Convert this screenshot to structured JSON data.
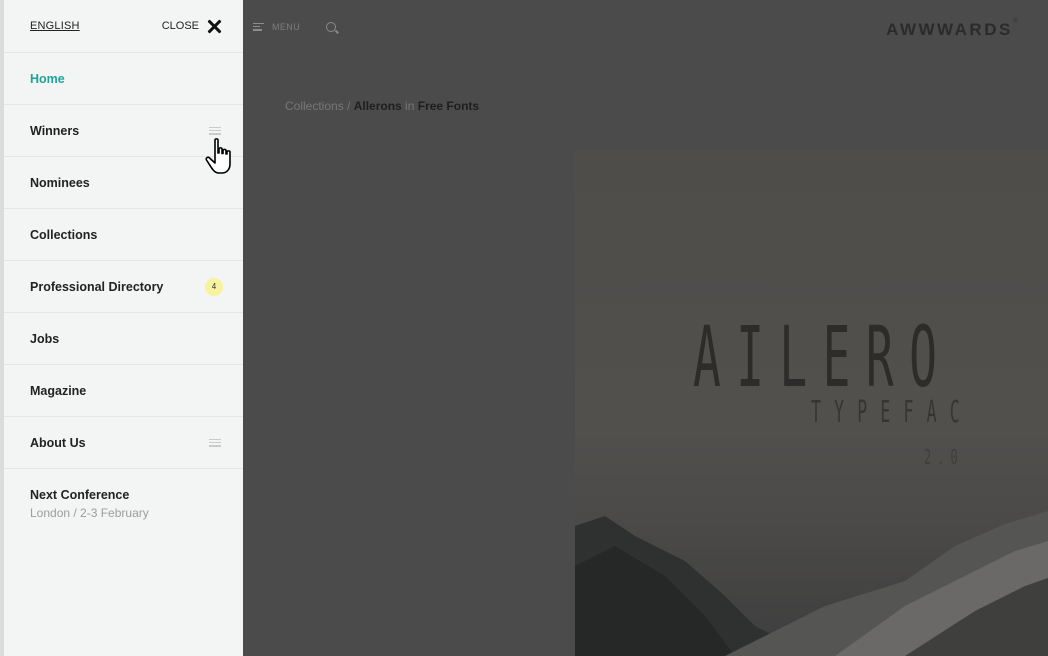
{
  "drawer": {
    "language": "ENGLISH",
    "close_label": "CLOSE",
    "items": [
      {
        "label": "Home",
        "active": true
      },
      {
        "label": "Winners",
        "has_submenu": true
      },
      {
        "label": "Nominees"
      },
      {
        "label": "Collections"
      },
      {
        "label": "Professional Directory",
        "badge": "4"
      },
      {
        "label": "Jobs"
      },
      {
        "label": "Magazine"
      },
      {
        "label": "About Us",
        "has_submenu": true
      }
    ],
    "conference": {
      "title": "Next Conference",
      "subtitle": "London / 2-3 February"
    }
  },
  "topbar": {
    "menu_label": "MENU",
    "brand": "AWWWARDS",
    "brand_mark": "®"
  },
  "breadcrumb": {
    "collections": "Collections / ",
    "item": "Allerons",
    "in": " in ",
    "category": "Free Fonts"
  },
  "poster": {
    "title": "AILERO",
    "subtitle": "TYPEFAC",
    "version": "2.0"
  },
  "colors": {
    "accent": "#1ea39c",
    "badge_bg": "#f7f2a0",
    "drawer_bg": "#f3f5f4",
    "overlay": "#4b4b4b"
  }
}
